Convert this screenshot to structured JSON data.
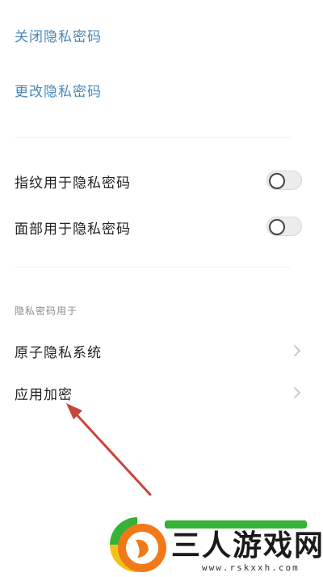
{
  "password_actions": {
    "close_label": "关闭隐私密码",
    "change_label": "更改隐私密码"
  },
  "biometrics": {
    "fingerprint_label": "指纹用于隐私密码",
    "fingerprint_enabled": false,
    "face_label": "面部用于隐私密码",
    "face_enabled": false
  },
  "usage_section": {
    "header": "隐私密码用于",
    "items": [
      {
        "label": "原子隐私系统"
      },
      {
        "label": "应用加密"
      }
    ]
  },
  "watermark": {
    "title": "三人游戏网",
    "url": "www.rskxxh.com"
  },
  "colors": {
    "link": "#4a86b8",
    "annotation_arrow": "#c8453a",
    "watermark_green": "#36b236",
    "watermark_orange": "#f07a1a"
  }
}
